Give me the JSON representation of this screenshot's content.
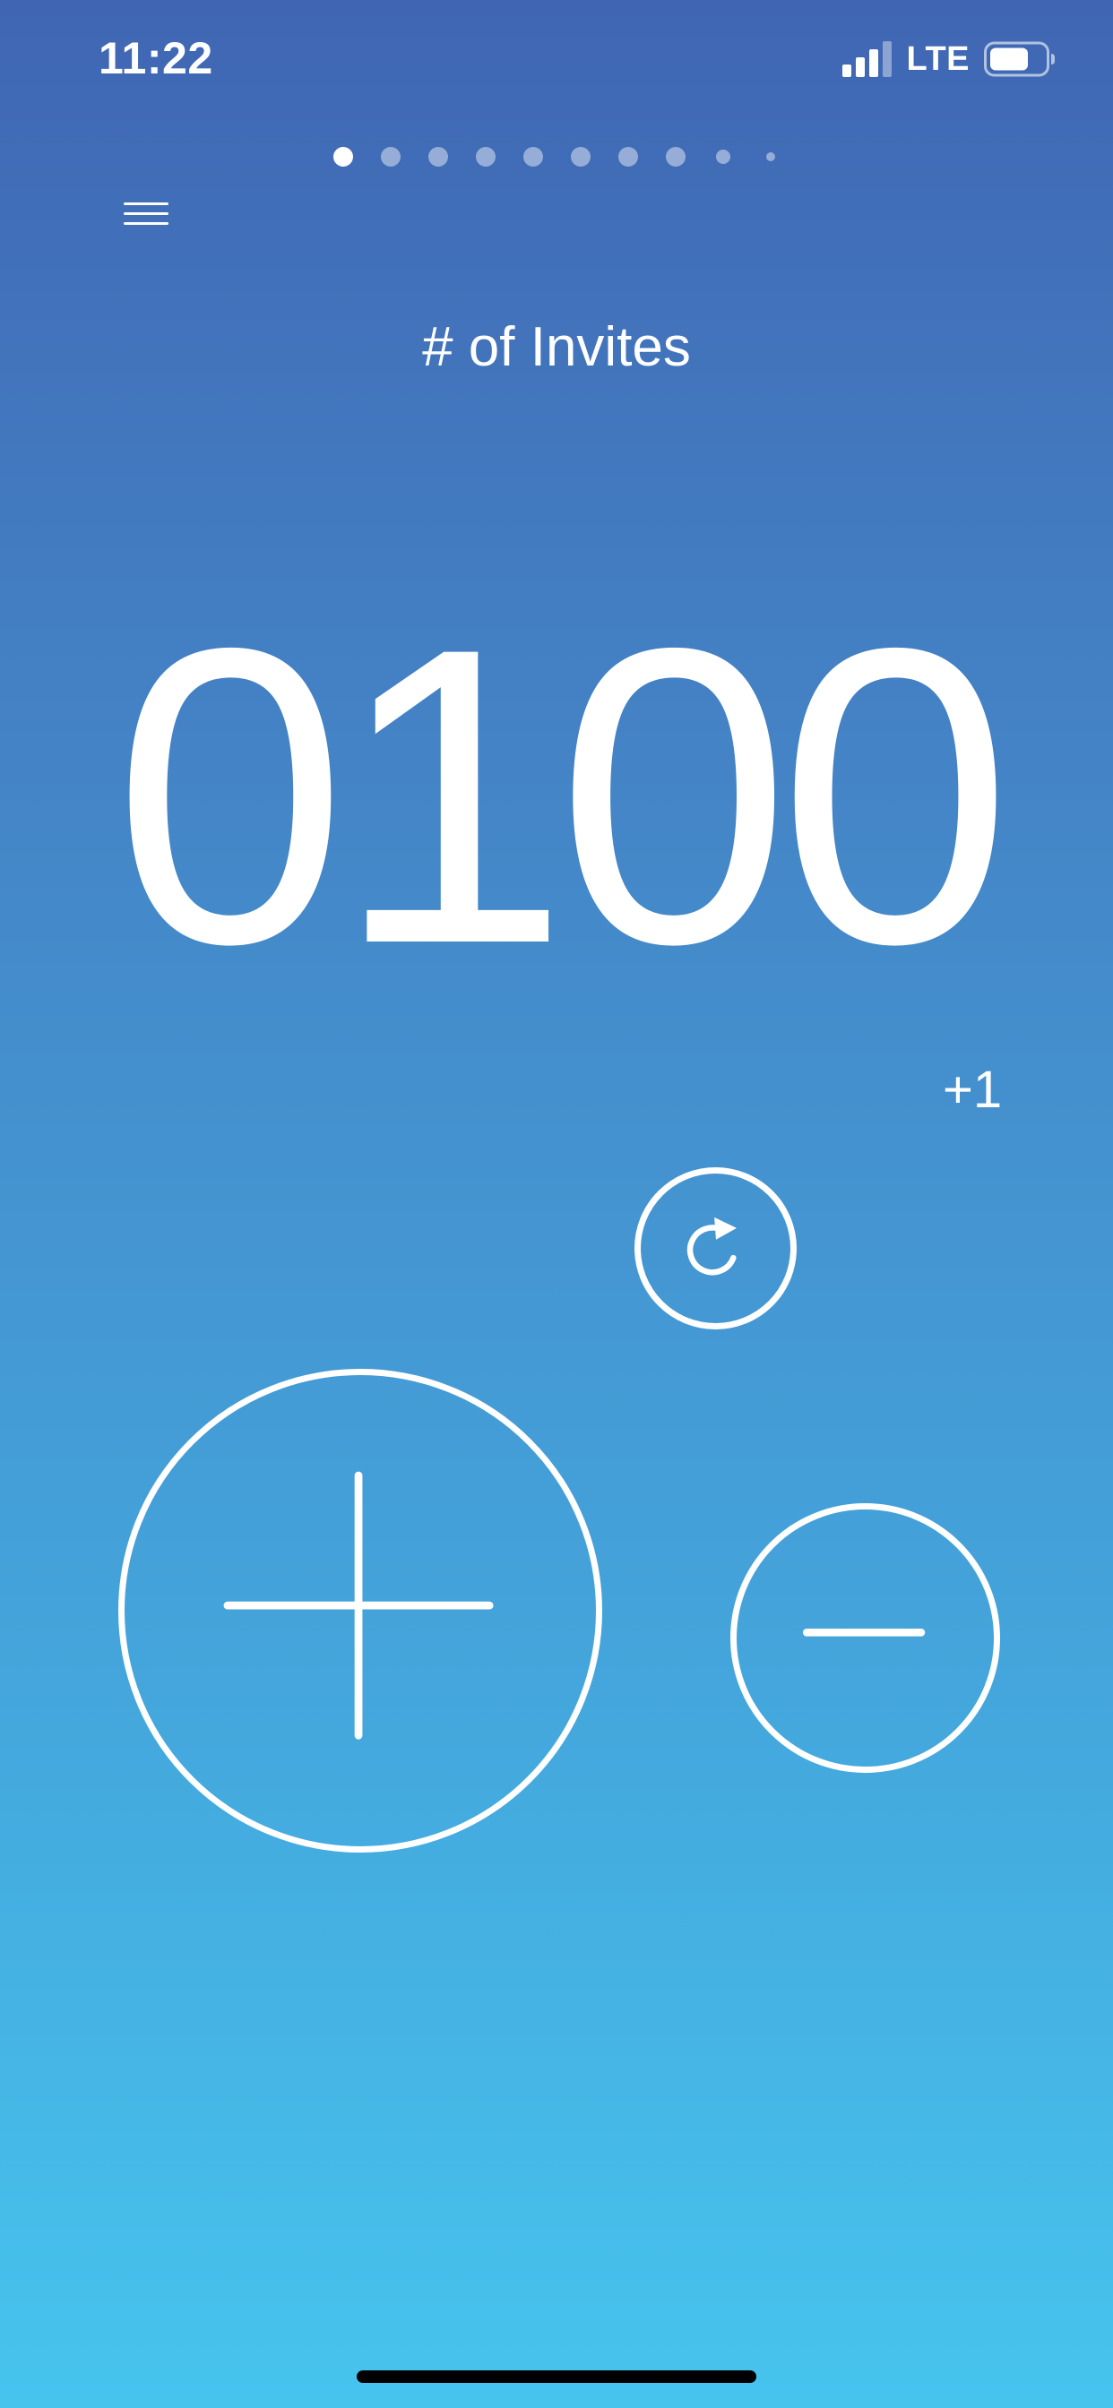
{
  "status_bar": {
    "time": "11:22",
    "network": "LTE",
    "signal_icon": "signal-bars-icon",
    "battery_icon": "battery-icon",
    "battery_level": 0.7
  },
  "pager": {
    "count": 10,
    "active_index": 0
  },
  "menu": {
    "icon": "hamburger-menu-icon"
  },
  "counter": {
    "title": "# of Invites",
    "value": "0100",
    "increment": "+1"
  },
  "controls": {
    "reset_icon": "reset-icon",
    "plus_icon": "plus-icon",
    "minus_icon": "minus-icon"
  },
  "colors": {
    "gradient_top": "#4066b3",
    "gradient_bottom": "#46c4ee",
    "foreground": "#ffffff"
  }
}
